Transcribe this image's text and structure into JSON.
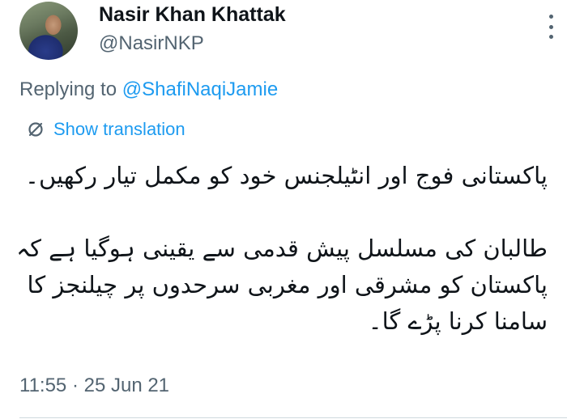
{
  "author": {
    "name": "Nasir Khan Khattak",
    "handle": "@NasirNKP"
  },
  "reply": {
    "prefix": "Replying to ",
    "mention": "@ShafiNaqiJamie"
  },
  "translate": {
    "label": "Show translation",
    "icon": "translate-icon"
  },
  "tweet": {
    "line1": "پاکستانی فوج اور انٹیلجنس خود کو مکمل تیار رکھیں۔",
    "line2": "طالبان کی مسلسل پیش قدمی سے یقینی ہوگیا ہے کہ",
    "line3": "پاکستان کو مشرقی اور مغربی سرحدوں پر چیلنجز کا",
    "line4": "سامنا کرنا پڑے گا۔"
  },
  "timestamp": "11:55 · 25 Jun 21",
  "colors": {
    "accent": "#1d9bf0",
    "secondary_text": "#536471",
    "primary_text": "#0f1419"
  }
}
